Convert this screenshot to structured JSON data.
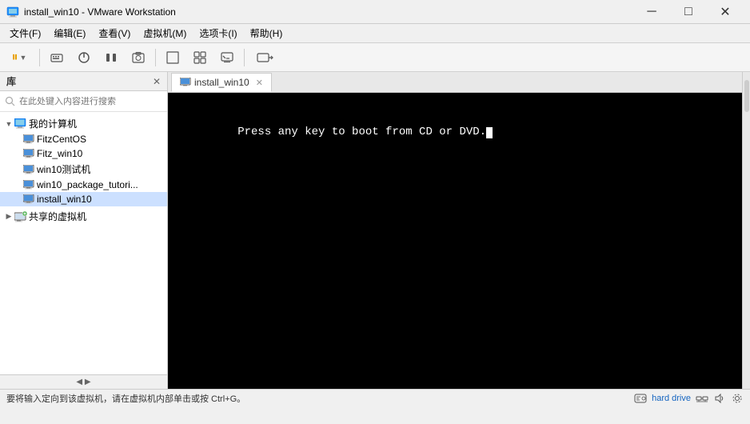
{
  "titleBar": {
    "icon": "vm",
    "title": "install_win10 - VMware Workstation",
    "minimize": "─",
    "maximize": "□",
    "close": "✕"
  },
  "menuBar": {
    "items": [
      "文件(F)",
      "编辑(E)",
      "查看(V)",
      "虚拟机(M)",
      "选项卡(I)",
      "帮助(H)"
    ]
  },
  "toolbar": {
    "buttons": [
      "pause",
      "send_ctrl_alt_del",
      "power_on",
      "suspend",
      "power_off",
      "snapshot",
      "fullscreen",
      "unity",
      "console",
      "settings"
    ]
  },
  "library": {
    "title": "库",
    "close": "✕",
    "search_placeholder": "在此处键入内容进行搜索",
    "tree": {
      "my_computer": {
        "label": "我的计算机",
        "expanded": true,
        "vms": [
          {
            "name": "FitzCentOS"
          },
          {
            "name": "Fitz_win10"
          },
          {
            "name": "win10测试机"
          },
          {
            "name": "win10_package_tutori..."
          },
          {
            "name": "install_win10",
            "selected": true
          }
        ]
      },
      "shared": {
        "label": "共享的虚拟机"
      }
    }
  },
  "vmTab": {
    "label": "install_win10",
    "close": "✕"
  },
  "consoleText": "Press any key to boot from CD or DVD.",
  "statusBar": {
    "text": "要将输入定向到该虚拟机，请在虚拟机内部单击或按 Ctrl+G。",
    "rightText": "hard drive"
  }
}
